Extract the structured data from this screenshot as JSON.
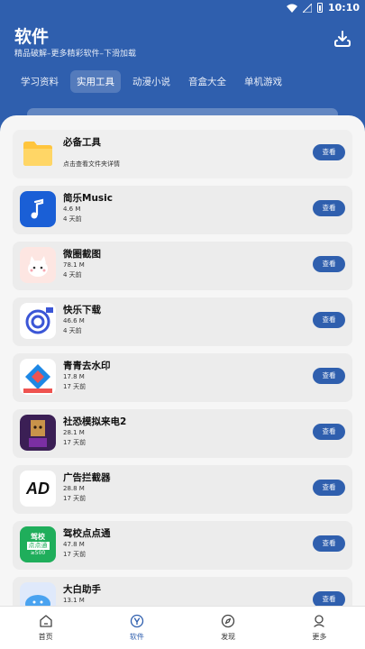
{
  "status_bar": {
    "time": "10:10"
  },
  "header": {
    "title": "软件",
    "subtitle": "精品破解–更多精彩软件–下滑加载"
  },
  "tabs": [
    {
      "label": "学习资料",
      "active": false
    },
    {
      "label": "实用工具",
      "active": true
    },
    {
      "label": "动漫小说",
      "active": false
    },
    {
      "label": "音盒大全",
      "active": false
    },
    {
      "label": "单机游戏",
      "active": false
    }
  ],
  "featured": {
    "name": "必备工具",
    "desc": "点击查看文件夹详情",
    "button": "查看",
    "icon": "folder-icon"
  },
  "apps": [
    {
      "name": "简乐Music",
      "size": "4.6 M",
      "time": "4 天前",
      "button": "查看",
      "icon": "music-note-icon"
    },
    {
      "name": "微圈截图",
      "size": "78.1 M",
      "time": "4 天前",
      "button": "查看",
      "icon": "cartoon-cat-icon"
    },
    {
      "name": "快乐下载",
      "size": "46.6 M",
      "time": "4 天前",
      "button": "查看",
      "icon": "download-circle-icon"
    },
    {
      "name": "青青去水印",
      "size": "17.8 M",
      "time": "17 天前",
      "button": "查看",
      "icon": "watermark-remover-icon"
    },
    {
      "name": "社恐模拟来电2",
      "size": "28.1 M",
      "time": "17 天前",
      "button": "查看",
      "icon": "box-character-icon"
    },
    {
      "name": "广告拦截器",
      "size": "28.8 M",
      "time": "17 天前",
      "button": "查看",
      "icon": "ad-block-icon"
    },
    {
      "name": "驾校点点通",
      "size": "47.8 M",
      "time": "17 天前",
      "button": "查看",
      "icon": "driving-school-icon"
    },
    {
      "name": "大白助手",
      "size": "13.1 M",
      "time": "",
      "button": "查看",
      "icon": "cloud-face-icon"
    }
  ],
  "icon_text": {
    "adblock": "AD",
    "driving_top": "驾校",
    "driving_mid": "点点通",
    "driving_bot": "≥500"
  },
  "bottom_nav": [
    {
      "label": "首页",
      "icon": "home-icon",
      "active": false
    },
    {
      "label": "软件",
      "icon": "app-store-icon",
      "active": true
    },
    {
      "label": "发现",
      "icon": "compass-icon",
      "active": false
    },
    {
      "label": "更多",
      "icon": "profile-icon",
      "active": false
    }
  ],
  "colors": {
    "primary": "#2f5fae",
    "panel": "#f6f6f6",
    "card": "#ececec"
  }
}
